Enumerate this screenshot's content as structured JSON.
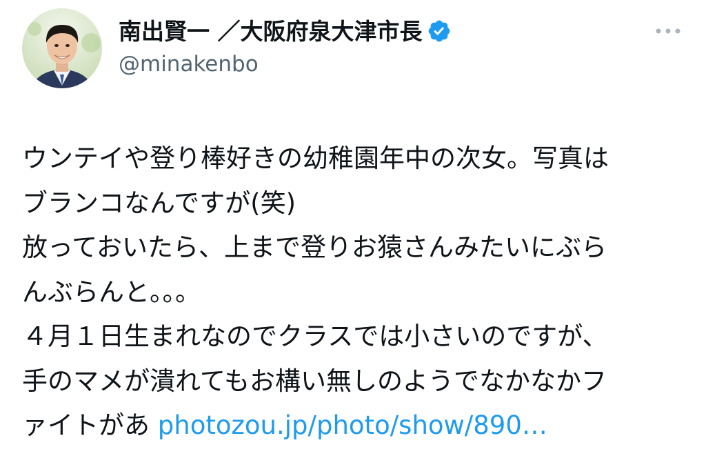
{
  "author": {
    "name": "南出賢一 ／大阪府泉大津市長",
    "handle": "@minakenbo",
    "verified_icon": "verified-badge-icon",
    "verified_color": "#1d9bf0"
  },
  "menu": {
    "icon": "more-options-icon"
  },
  "tweet": {
    "lines": [
      "ウンテイや登り棒好きの幼稚園年中の次女。写真は",
      "ブランコなんですが(笑)",
      "放っておいたら、上まで登りお猿さんみたいにぶら",
      "んぶらんと。。。",
      "４月１日生まれなのでクラスでは小さいのですが、",
      "手のマメが潰れてもお構い無しのようでなかなかフ"
    ],
    "last_line_text": "ァイトがあ ",
    "link_text": "photozou.jp/photo/show/890…",
    "link_color": "#1d9bf0"
  }
}
